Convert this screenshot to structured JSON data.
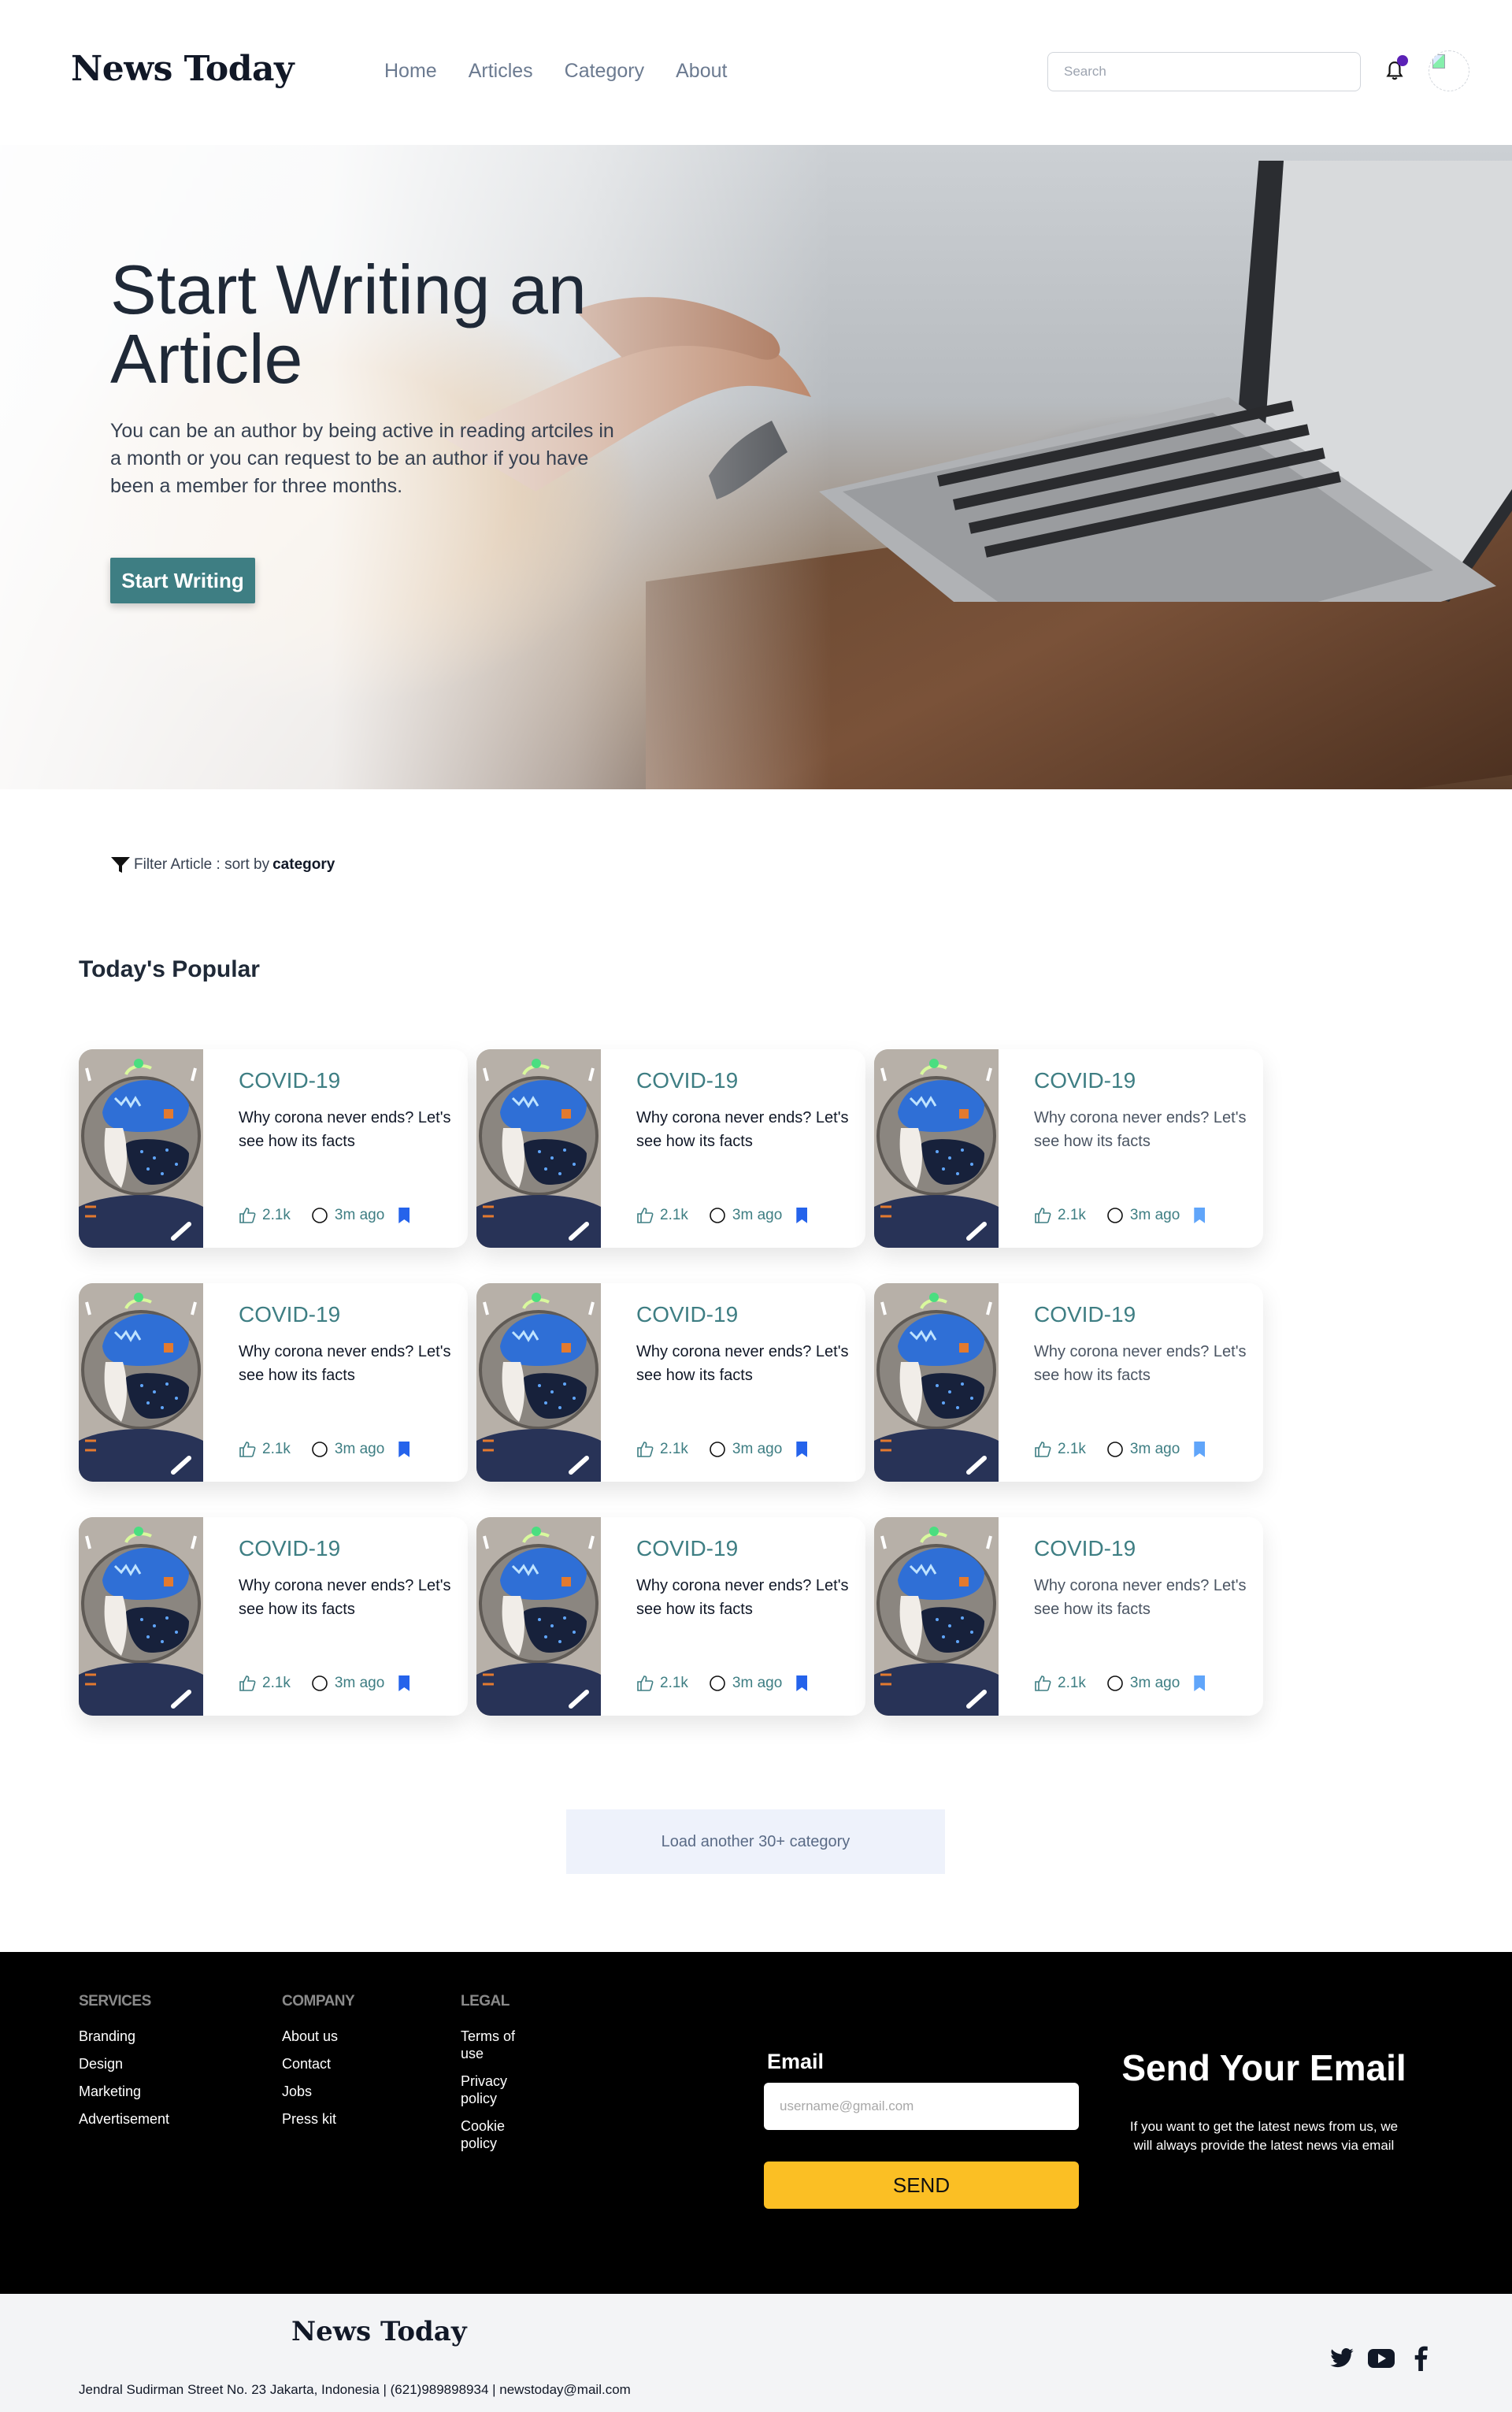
{
  "header": {
    "logo": "News Today",
    "nav": [
      "Home",
      "Articles",
      "Category",
      "About"
    ],
    "search_placeholder": "Search"
  },
  "hero": {
    "title": "Start Writing an Article",
    "text": "You can be an author by being active in reading artciles in a month or you can request to be an author if you have been a member for three months.",
    "button": "Start Writing"
  },
  "filter": {
    "prefix": "Filter Article : sort by",
    "value": "category"
  },
  "popular": {
    "title": "Today's Popular",
    "cards": [
      {
        "category": "COVID-19",
        "title": "Why corona never ends? Let's see how its facts",
        "likes": "2.1k",
        "time": "3m ago"
      },
      {
        "category": "COVID-19",
        "title": "Why corona never ends? Let's see how its facts",
        "likes": "2.1k",
        "time": "3m ago"
      },
      {
        "category": "COVID-19",
        "title": "Why corona never ends? Let's see how its facts",
        "likes": "2.1k",
        "time": "3m ago"
      },
      {
        "category": "COVID-19",
        "title": "Why corona never ends? Let's see how its facts",
        "likes": "2.1k",
        "time": "3m ago"
      },
      {
        "category": "COVID-19",
        "title": "Why corona never ends? Let's see how its facts",
        "likes": "2.1k",
        "time": "3m ago"
      },
      {
        "category": "COVID-19",
        "title": "Why corona never ends? Let's see how its facts",
        "likes": "2.1k",
        "time": "3m ago"
      },
      {
        "category": "COVID-19",
        "title": "Why corona never ends? Let's see how its facts",
        "likes": "2.1k",
        "time": "3m ago"
      },
      {
        "category": "COVID-19",
        "title": "Why corona never ends? Let's see how its facts",
        "likes": "2.1k",
        "time": "3m ago"
      },
      {
        "category": "COVID-19",
        "title": "Why corona never ends? Let's see how its facts",
        "likes": "2.1k",
        "time": "3m ago"
      }
    ],
    "load_more": "Load another 30+ category"
  },
  "footer": {
    "services": {
      "heading": "SERVICES",
      "links": [
        "Branding",
        "Design",
        "Marketing",
        "Advertisement"
      ]
    },
    "company": {
      "heading": "COMPANY",
      "links": [
        "About us",
        "Contact",
        "Jobs",
        "Press kit"
      ]
    },
    "legal": {
      "heading": "LEGAL",
      "links": [
        "Terms of use",
        "Privacy policy",
        "Cookie policy"
      ]
    },
    "email_label": "Email",
    "email_placeholder": "username@gmail.com",
    "send_button": "SEND",
    "send_title": "Send Your Email",
    "send_text": "If you want to get the latest news from us, we will always provide the latest news via email"
  },
  "bottom": {
    "logo": "News Today",
    "address": "Jendral Sudirman Street No. 23 Jakarta, Indonesia | (621)989898934 | newstoday@mail.com",
    "social_icons": [
      "twitter-icon",
      "youtube-icon",
      "facebook-icon"
    ]
  },
  "colors": {
    "accent": "#3e7e83",
    "send": "#fbbf24",
    "bookmark": "#2563eb",
    "notification": "#5b21b6"
  }
}
